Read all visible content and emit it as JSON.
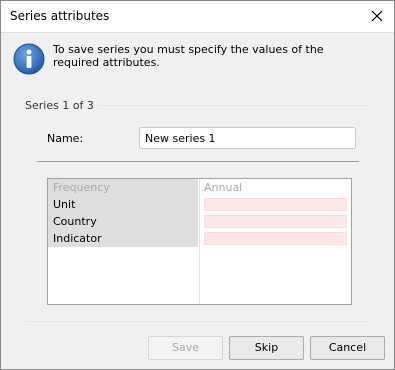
{
  "window": {
    "title": "Series attributes"
  },
  "info": {
    "message": "To save series you must specify the values of the required attributes."
  },
  "group": {
    "label": "Series 1 of 3"
  },
  "name_field": {
    "label": "Name:",
    "value": "New series 1"
  },
  "attributes": [
    {
      "name": "Frequency",
      "value": "Annual",
      "disabled": true
    },
    {
      "name": "Unit",
      "value": "",
      "required": true
    },
    {
      "name": "Country",
      "value": "",
      "required": true
    },
    {
      "name": "Indicator",
      "value": "",
      "required": true
    }
  ],
  "buttons": {
    "save": "Save",
    "skip": "Skip",
    "cancel": "Cancel"
  },
  "colors": {
    "required_fill": "#fde8e8",
    "info_blue": "#2f6fc0"
  }
}
